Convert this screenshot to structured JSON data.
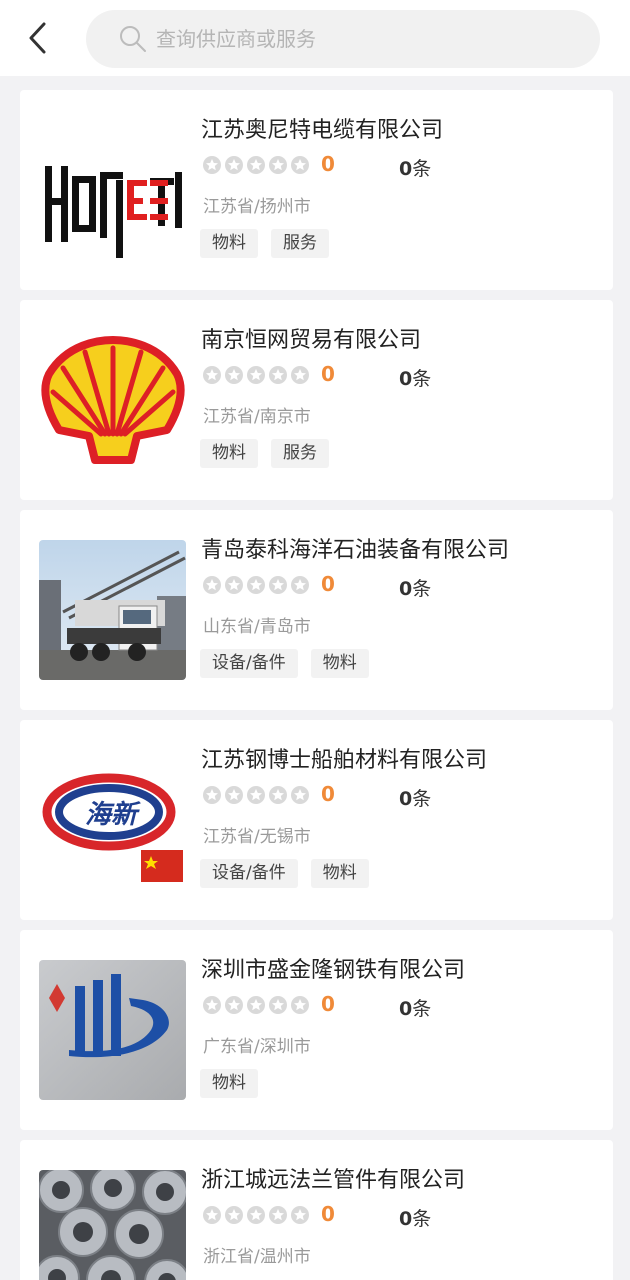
{
  "search": {
    "placeholder": "查询供应商或服务",
    "value": ""
  },
  "suppliers": [
    {
      "name": "江苏奥尼特电缆有限公司",
      "score": "0",
      "count": "0",
      "count_unit": "条",
      "region": "江苏省/扬州市",
      "tags": [
        "物料",
        "服务"
      ],
      "logo": "HONEST wordmark logo"
    },
    {
      "name": "南京恒网贸易有限公司",
      "score": "0",
      "count": "0",
      "count_unit": "条",
      "region": "江苏省/南京市",
      "tags": [
        "物料",
        "服务"
      ],
      "logo": "shell logo"
    },
    {
      "name": "青岛泰科海洋石油装备有限公司",
      "score": "0",
      "count": "0",
      "count_unit": "条",
      "region": "山东省/青岛市",
      "tags": [
        "设备/备件",
        "物料"
      ],
      "logo": "drilling truck photo"
    },
    {
      "name": "江苏钢博士船舶材料有限公司",
      "score": "0",
      "count": "0",
      "count_unit": "条",
      "region": "江苏省/无锡市",
      "tags": [
        "设备/备件",
        "物料"
      ],
      "logo": "海新 logo",
      "logo_text": "海新"
    },
    {
      "name": "深圳市盛金隆钢铁有限公司",
      "score": "0",
      "count": "0",
      "count_unit": "条",
      "region": "广东省/深圳市",
      "tags": [
        "物料"
      ],
      "logo": "blue steel logo"
    },
    {
      "name": "浙江城远法兰管件有限公司",
      "score": "0",
      "count": "0",
      "count_unit": "条",
      "region": "浙江省/温州市",
      "tags": [],
      "logo": "flange parts photo"
    }
  ],
  "colors": {
    "score": "#f08a38",
    "background": "#f2f2f4",
    "star": "#d9d9d9"
  },
  "icons": {
    "back": "chevron-left-icon",
    "search": "search-icon",
    "rating": "star-icon"
  }
}
